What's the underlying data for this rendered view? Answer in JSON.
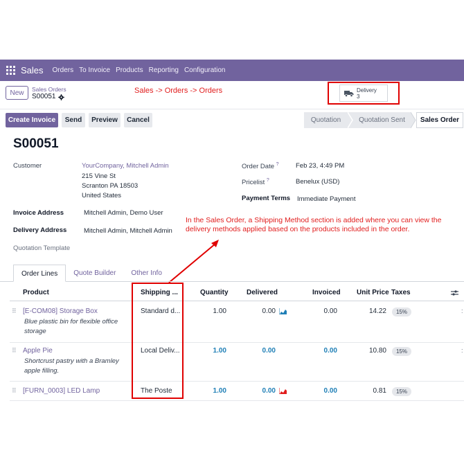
{
  "topbar": {
    "brand": "Sales",
    "nav": [
      "Orders",
      "To Invoice",
      "Products",
      "Reporting",
      "Configuration"
    ]
  },
  "control": {
    "new_label": "New",
    "breadcrumb_parent": "Sales Orders",
    "breadcrumb_current": "S00051",
    "annotation": "Sales -> Orders -> Orders",
    "delivery_label": "Delivery",
    "delivery_count": "3"
  },
  "actions": {
    "create_invoice": "Create Invoice",
    "send": "Send",
    "preview": "Preview",
    "cancel": "Cancel",
    "stages": [
      "Quotation",
      "Quotation Sent",
      "Sales Order"
    ],
    "active_stage": "Sales Order"
  },
  "order": {
    "id": "S00051",
    "customer_label": "Customer",
    "customer_name": "YourCompany, Mitchell Admin",
    "address_line1": "215 Vine St",
    "address_line2": "Scranton PA 18503",
    "address_line3": "United States",
    "invoice_address_label": "Invoice Address",
    "invoice_address": "Mitchell Admin, Demo User",
    "delivery_address_label": "Delivery Address",
    "delivery_address": "Mitchell Admin, Mitchell Admin",
    "quotation_template_label": "Quotation Template",
    "order_date_label": "Order Date",
    "order_date": "Feb 23, 4:49 PM",
    "pricelist_label": "Pricelist",
    "pricelist": "Benelux (USD)",
    "payment_terms_label": "Payment Terms",
    "payment_terms": "Immediate Payment",
    "help_mark": "?"
  },
  "annotation_main": "In the Sales Order, a Shipping Method section is added where you can view the delivery methods applied based on the products included in the order.",
  "tabs": [
    "Order Lines",
    "Quote Builder",
    "Other Info"
  ],
  "table": {
    "headers": {
      "product": "Product",
      "shipping": "Shipping ...",
      "quantity": "Quantity",
      "delivered": "Delivered",
      "invoiced": "Invoiced",
      "unit_price": "Unit Price",
      "taxes": "Taxes"
    },
    "rows": [
      {
        "product": "[E-COM08] Storage Box",
        "description": "Blue plastic bin for flexible office storage",
        "shipping": "Standard d...",
        "quantity": "1.00",
        "delivered": "0.00",
        "invoiced": "0.00",
        "unit_price": "14.22",
        "tax": "15%"
      },
      {
        "product": "Apple Pie",
        "description": "Shortcrust pastry with a Bramley apple filling.",
        "shipping": "Local Deliv...",
        "quantity": "1.00",
        "delivered": "0.00",
        "invoiced": "0.00",
        "unit_price": "10.80",
        "tax": "15%"
      },
      {
        "product": "[FURN_0003] LED Lamp",
        "description": "",
        "shipping": "The Poste",
        "quantity": "1.00",
        "delivered": "0.00",
        "invoiced": "0.00",
        "unit_price": "0.81",
        "tax": "15%"
      }
    ]
  },
  "colors": {
    "brand": "#71639e",
    "annotation": "#e00000",
    "qty_blue": "#1f7fb6"
  }
}
